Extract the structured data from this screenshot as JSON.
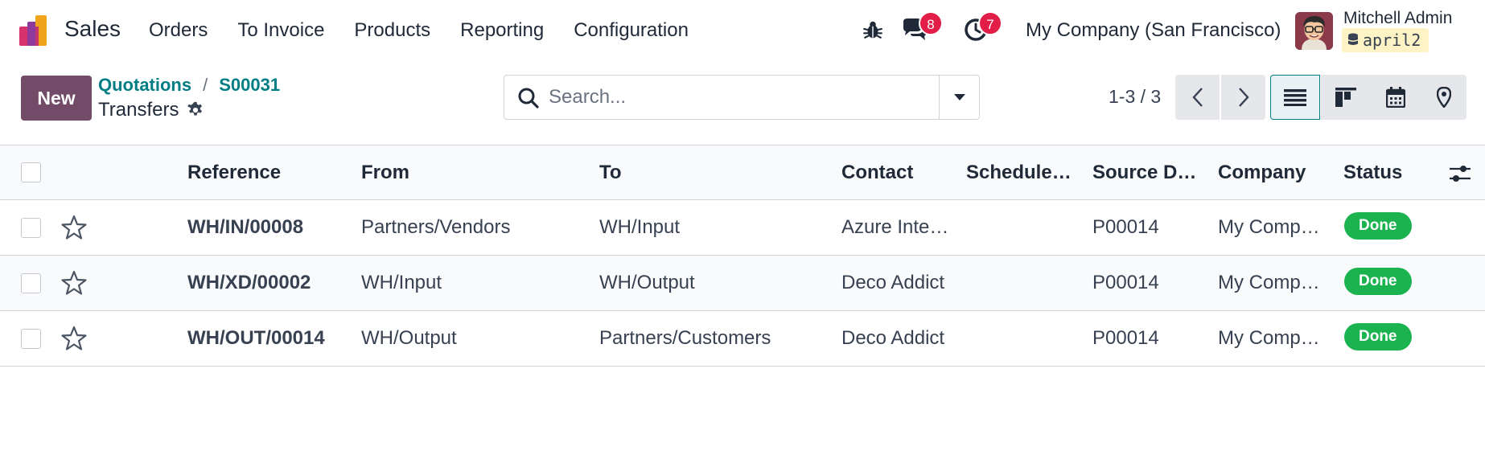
{
  "navbar": {
    "app_name": "Sales",
    "menu": [
      "Orders",
      "To Invoice",
      "Products",
      "Reporting",
      "Configuration"
    ],
    "messages_count": "8",
    "activities_count": "7",
    "company": "My Company (San Francisco)",
    "user_name": "Mitchell Admin",
    "database": "april2"
  },
  "control_panel": {
    "new_label": "New",
    "breadcrumb": [
      "Quotations",
      "S00031"
    ],
    "breadcrumb_separator": "/",
    "view_title": "Transfers",
    "search_placeholder": "Search...",
    "pager": "1-3 / 3",
    "views": [
      "list-icon",
      "kanban-icon",
      "calendar-icon",
      "map-pin-icon"
    ],
    "active_view": "list"
  },
  "table": {
    "columns": [
      "Reference",
      "From",
      "To",
      "Contact",
      "Schedule…",
      "Source D…",
      "Company",
      "Status"
    ],
    "rows": [
      {
        "reference": "WH/IN/00008",
        "from": "Partners/Vendors",
        "to": "WH/Input",
        "contact": "Azure Inte…",
        "scheduled": "",
        "source": "P00014",
        "company": "My Comp…",
        "status": "Done"
      },
      {
        "reference": "WH/XD/00002",
        "from": "WH/Input",
        "to": "WH/Output",
        "contact": "Deco Addict",
        "scheduled": "",
        "source": "P00014",
        "company": "My Comp…",
        "status": "Done"
      },
      {
        "reference": "WH/OUT/00014",
        "from": "WH/Output",
        "to": "Partners/Customers",
        "contact": "Deco Addict",
        "scheduled": "",
        "source": "P00014",
        "company": "My Comp…",
        "status": "Done"
      }
    ]
  },
  "colors": {
    "brand": "#714b67",
    "link": "#017e84",
    "badge": "#e11d48",
    "status_done": "#1ab34f"
  }
}
